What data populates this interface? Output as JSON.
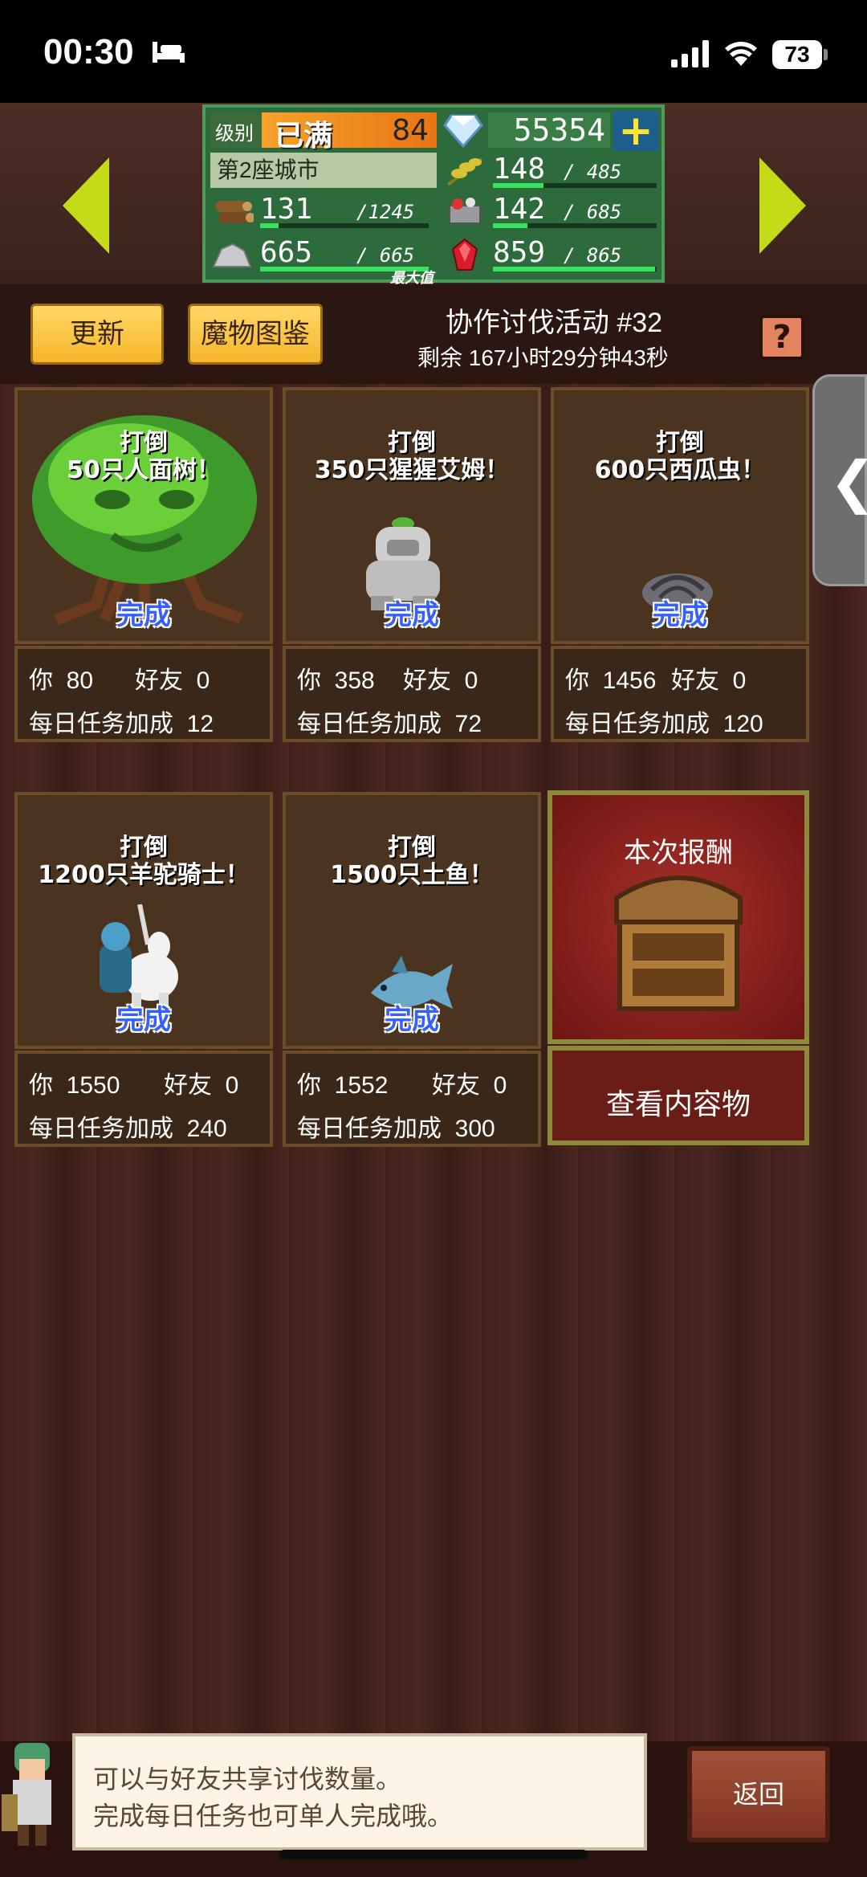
{
  "status_bar": {
    "time": "00:30",
    "battery": "73"
  },
  "resources": {
    "level_label": "级别",
    "level_full": "已满",
    "level_value": "84",
    "gems": "55354",
    "plus": "+",
    "city": "第2座城市",
    "food_value": "148",
    "food_max": "485",
    "food_fill": 0.31,
    "wood_value": "131",
    "wood_max": "1245",
    "wood_fill": 0.11,
    "ore_value": "142",
    "ore_max": "685",
    "ore_fill": 0.21,
    "stone_value": "665",
    "stone_max": "665",
    "stone_fill": 1.0,
    "stone_max_label": "最大值",
    "ruby_value": "859",
    "ruby_max": "865",
    "ruby_fill": 0.99
  },
  "header": {
    "refresh_label": "更新",
    "bestiary_label": "魔物图鉴",
    "event_title": "协作讨伐活动 #32",
    "remaining": "剩余 167小时29分钟43秒",
    "help_label": "?"
  },
  "quests": [
    {
      "line1": "打倒",
      "line2": "50只人面树！",
      "done": "完成",
      "you_label": "你",
      "you_value": "80",
      "friend_label": "好友",
      "friend_value": "0",
      "bonus_label": "每日任务加成",
      "bonus_value": "12",
      "monster": "tree-monster-icon"
    },
    {
      "line1": "打倒",
      "line2": "350只猩猩艾姆！",
      "done": "完成",
      "you_label": "你",
      "you_value": "358",
      "friend_label": "好友",
      "friend_value": "0",
      "bonus_label": "每日任务加成",
      "bonus_value": "72",
      "monster": "gorilla-monster-icon"
    },
    {
      "line1": "打倒",
      "line2": "600只西瓜虫！",
      "done": "完成",
      "you_label": "你",
      "you_value": "1456",
      "friend_label": "好友",
      "friend_value": "0",
      "bonus_label": "每日任务加成",
      "bonus_value": "120",
      "monster": "pillbug-monster-icon"
    },
    {
      "line1": "打倒",
      "line2": "1200只羊驼骑士！",
      "done": "完成",
      "you_label": "你",
      "you_value": "1550",
      "friend_label": "好友",
      "friend_value": "0",
      "bonus_label": "每日任务加成",
      "bonus_value": "240",
      "monster": "alpaca-knight-icon"
    },
    {
      "line1": "打倒",
      "line2": "1500只土鱼！",
      "done": "完成",
      "you_label": "你",
      "you_value": "1552",
      "friend_label": "好友",
      "friend_value": "0",
      "bonus_label": "每日任务加成",
      "bonus_value": "300",
      "monster": "land-fish-icon"
    }
  ],
  "reward": {
    "title": "本次报酬",
    "button": "查看内容物"
  },
  "tip": {
    "line1": "可以与好友共享讨伐数量。",
    "line2": "完成每日任务也可单人完成哦。"
  },
  "back_label": "返回",
  "colors": {
    "accent_yellow": "#f6b52a",
    "done_blue": "#3560ff",
    "panel_green": "#2d6a3c"
  }
}
